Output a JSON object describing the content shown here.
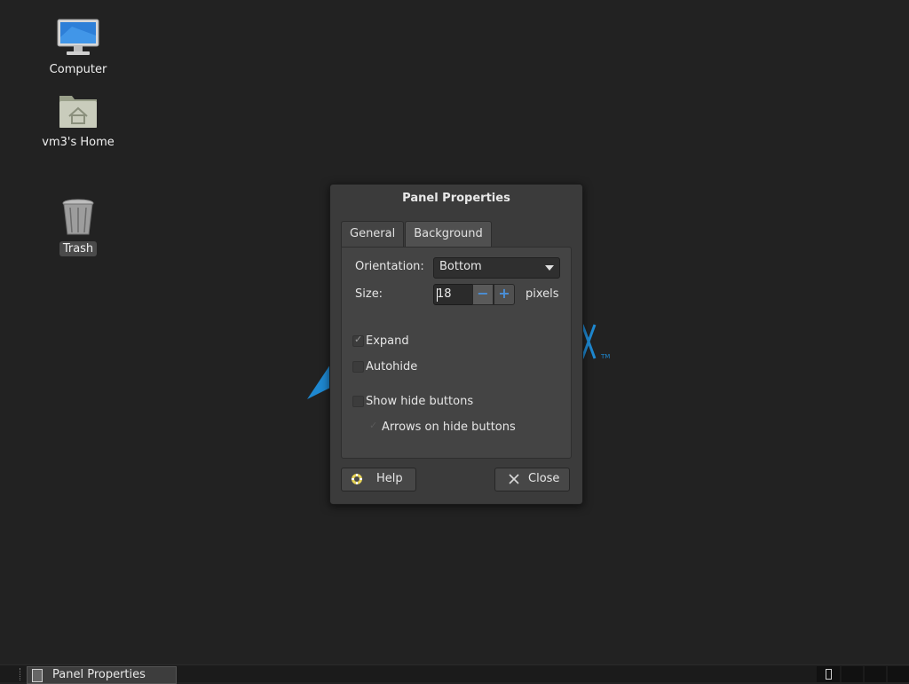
{
  "desktop": {
    "icons": [
      {
        "label": "Computer"
      },
      {
        "label": "vm3's Home"
      },
      {
        "label": "Trash"
      }
    ],
    "accent_color": "#1e88d0"
  },
  "dialog": {
    "title": "Panel Properties",
    "tabs": [
      {
        "label": "General",
        "active": true
      },
      {
        "label": "Background",
        "active": false
      }
    ],
    "orientation": {
      "label": "Orientation:",
      "value": "Bottom"
    },
    "size": {
      "label": "Size:",
      "value": "18",
      "unit": "pixels",
      "minus_icon": "minus-icon",
      "plus_icon": "plus-icon"
    },
    "checks": [
      {
        "label": "Expand",
        "checked": true,
        "enabled": true
      },
      {
        "label": "Autohide",
        "checked": false,
        "enabled": true
      },
      {
        "label": "Show hide buttons",
        "checked": false,
        "enabled": true
      },
      {
        "label": "Arrows on hide buttons",
        "checked": true,
        "enabled": false
      }
    ],
    "buttons": {
      "help": {
        "label": "Help",
        "icon": "lifebuoy-icon"
      },
      "close": {
        "label": "Close",
        "icon": "close-icon"
      }
    }
  },
  "taskbar": {
    "task": {
      "label": "Panel Properties"
    }
  }
}
